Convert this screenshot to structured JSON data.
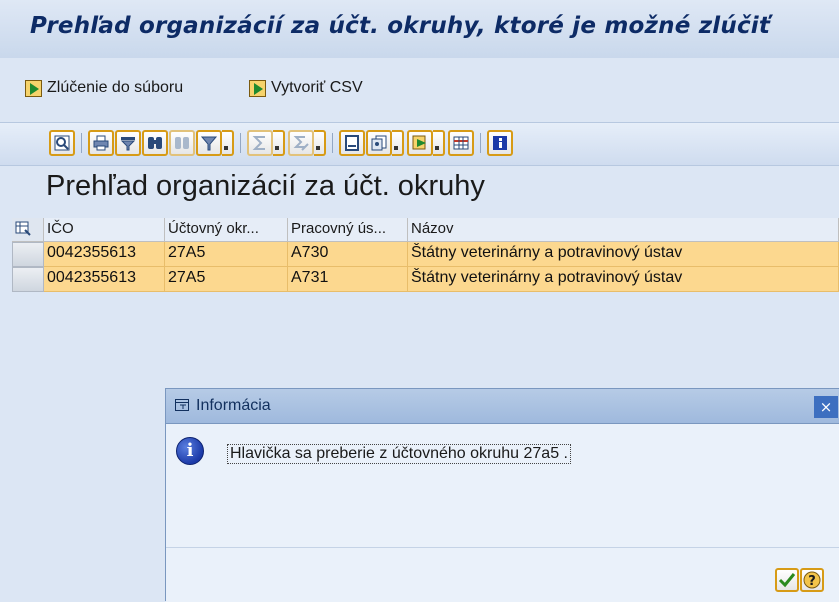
{
  "window": {
    "title": "Prehľad organizácií za účt. okruhy, ktoré je možné zlúčiť"
  },
  "app_toolbar": {
    "merge_to_file_label": "Zlúčenie do súboru",
    "create_csv_label": "Vytvoriť CSV"
  },
  "alv_toolbar": {
    "icons": [
      "details-icon",
      "print-icon",
      "filter-icon",
      "find-icon",
      "find-next-icon",
      "set-filter-icon",
      "sum-icon",
      "subtotal-icon",
      "print-preview-icon",
      "layout-icon",
      "export-icon",
      "grid-view-icon",
      "info-icon"
    ]
  },
  "section": {
    "heading": "Prehľad organizácií za účt. okruhy"
  },
  "table": {
    "columns": [
      "IČO",
      "Účtovný okr...",
      "Pracovný ús...",
      "Názov"
    ],
    "rows": [
      [
        "0042355613",
        "27A5",
        "A730",
        "Štátny veterinárny a potravinový ústav"
      ],
      [
        "0042355613",
        "27A5",
        "A731",
        "Štátny veterinárny a potravinový ústav"
      ]
    ],
    "row_color": "#fcd88f"
  },
  "dialog": {
    "title": "Informácia",
    "close_glyph": "×",
    "info_glyph": "i",
    "message": "Hlavička sa preberie z účtovného okruhu 27a5 ."
  }
}
